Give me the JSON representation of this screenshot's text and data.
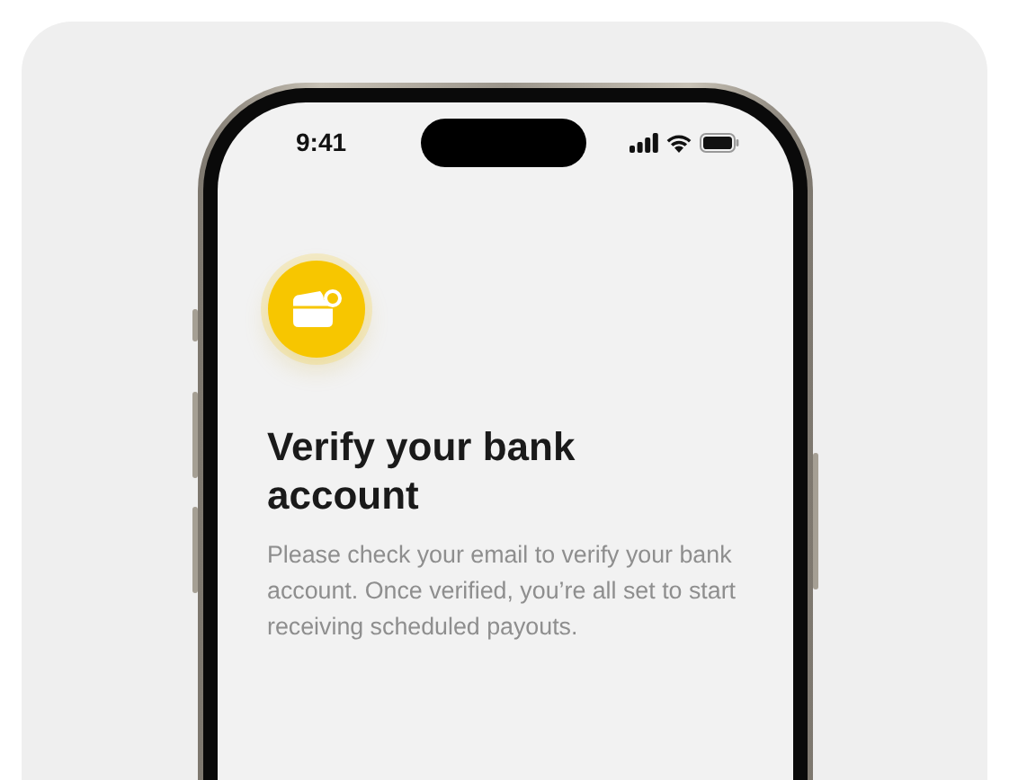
{
  "status_bar": {
    "time": "9:41"
  },
  "title": "Verify your bank account",
  "message": "Please check your email to verify your bank account. Once verified, you’re all set to start receiving scheduled payouts."
}
